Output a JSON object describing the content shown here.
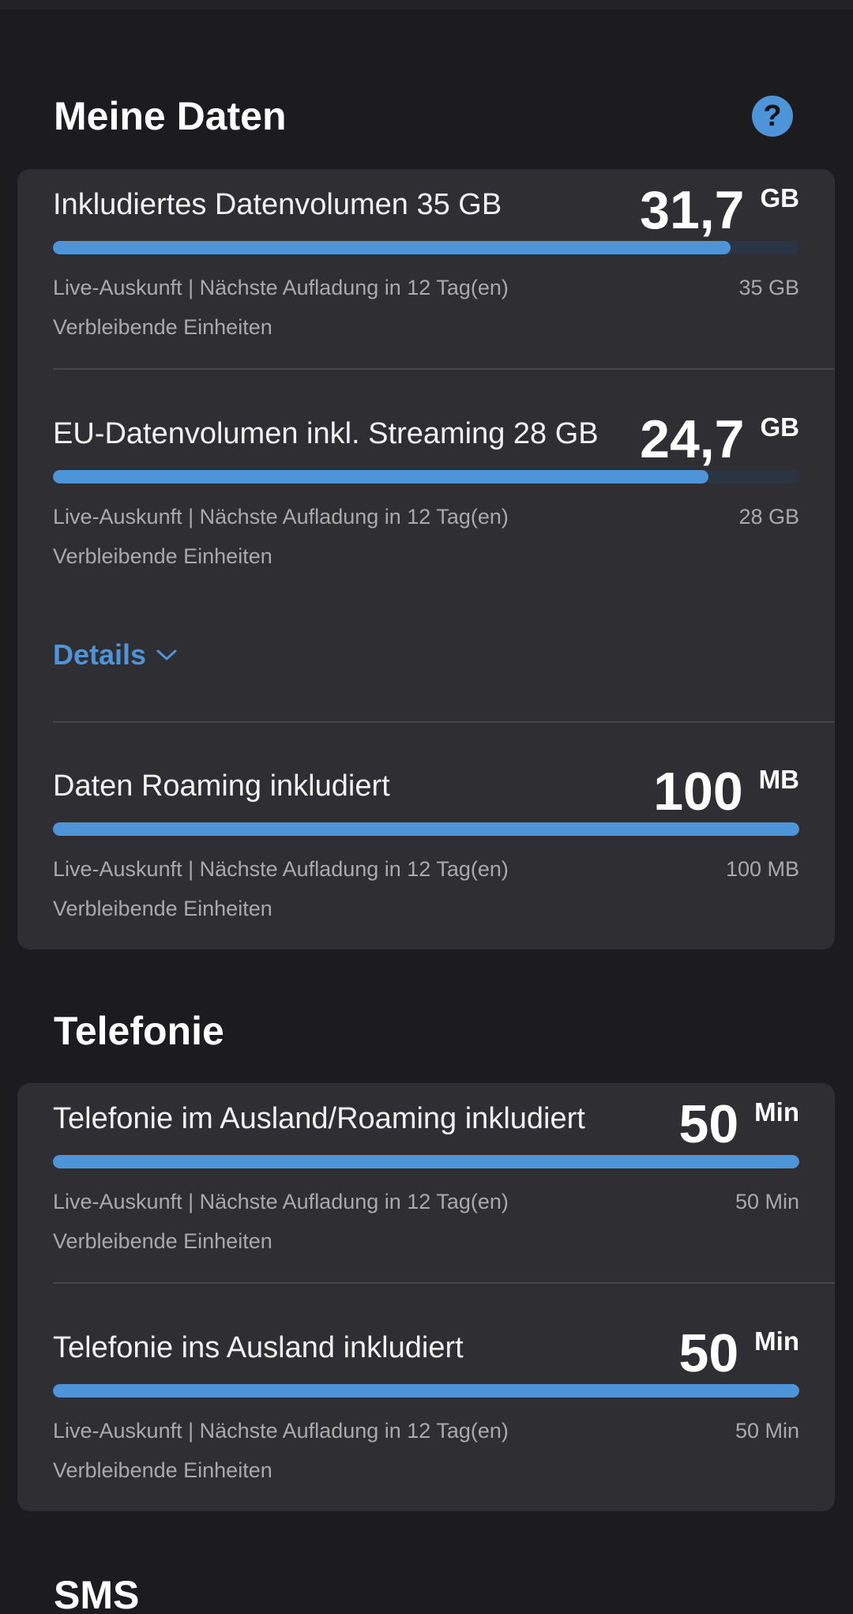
{
  "header": {
    "title": "Meine Daten"
  },
  "data_items": [
    {
      "title": "Inkludiertes Datenvolumen 35 GB",
      "amount": "31,7",
      "unit": "GB",
      "remaining_fraction": 0.908,
      "info": "Live-Auskunft | Nächste Aufladung in 12 Tag(en)",
      "total": "35 GB",
      "sub": "Verbleibende Einheiten"
    },
    {
      "title": "EU-Datenvolumen inkl. Streaming 28 GB",
      "amount": "24,7",
      "unit": "GB",
      "remaining_fraction": 0.878,
      "info": "Live-Auskunft | Nächste Aufladung in 12 Tag(en)",
      "total": "28 GB",
      "sub": "Verbleibende Einheiten"
    },
    {
      "title": "Daten Roaming inkludiert",
      "amount": "100",
      "unit": "MB",
      "remaining_fraction": 1.0,
      "info": "Live-Auskunft | Nächste Aufladung in 12 Tag(en)",
      "total": "100 MB",
      "sub": "Verbleibende Einheiten"
    }
  ],
  "details_label": "Details",
  "telefonie": {
    "title": "Telefonie",
    "items": [
      {
        "title": "Telefonie im Ausland/Roaming inkludiert",
        "amount": "50",
        "unit": "Min",
        "remaining_fraction": 1.0,
        "info": "Live-Auskunft | Nächste Aufladung in 12 Tag(en)",
        "total": "50 Min",
        "sub": "Verbleibende Einheiten"
      },
      {
        "title": "Telefonie ins Ausland inkludiert",
        "amount": "50",
        "unit": "Min",
        "remaining_fraction": 1.0,
        "info": "Live-Auskunft | Nächste Aufladung in 12 Tag(en)",
        "total": "50 Min",
        "sub": "Verbleibende Einheiten"
      }
    ]
  },
  "sms": {
    "title": "SMS"
  },
  "colors": {
    "accent": "#4d94d8",
    "background": "#1c1c1f",
    "card": "#2e2e33",
    "track": "#2a3442"
  },
  "icons": {
    "help": "question-mark-icon",
    "details": "chevron-down-icon"
  }
}
